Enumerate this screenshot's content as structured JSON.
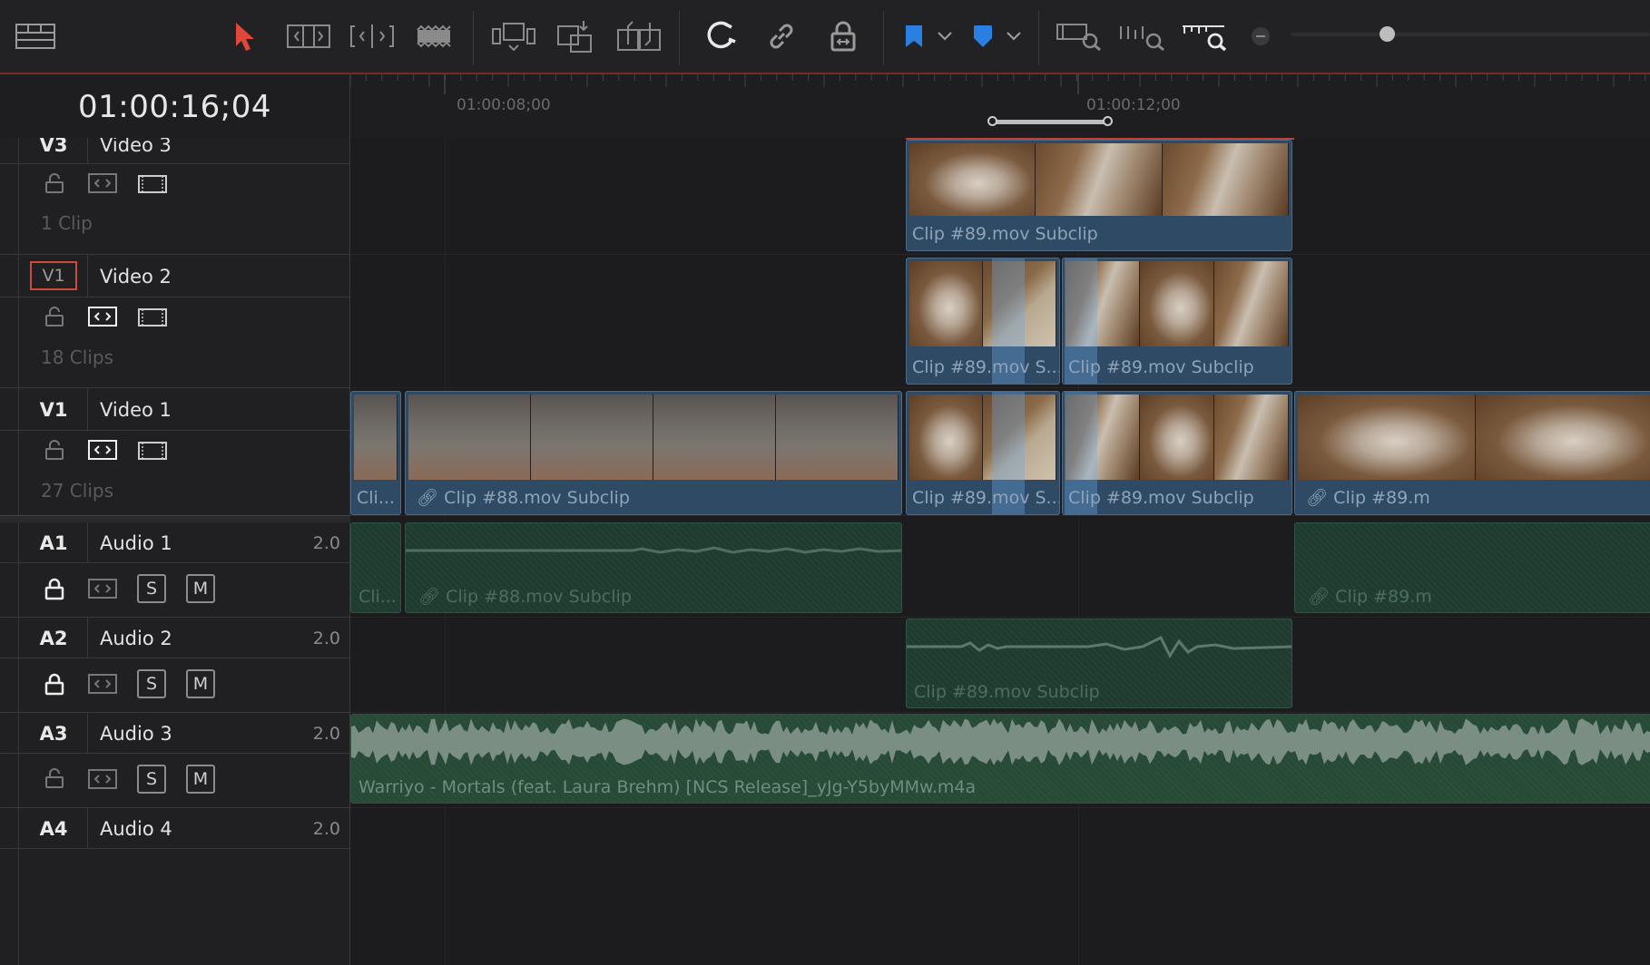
{
  "timecode": "01:00:16;04",
  "ruler": {
    "marks": [
      "01:00:08;00",
      "01:00:12;00"
    ]
  },
  "toolbar": {
    "icons": [
      "timeline-view-icon",
      "selection-arrow-icon",
      "trim-edit-icon",
      "dynamic-trim-icon",
      "blade-edit-icon",
      "insert-clip-icon",
      "overwrite-clip-icon",
      "replace-clip-icon",
      "snapping-icon",
      "linked-selection-icon",
      "position-lock-icon",
      "flag-icon",
      "marker-icon",
      "zoom-full-icon",
      "zoom-detail-icon",
      "zoom-custom-icon",
      "zoom-out-icon"
    ]
  },
  "tracks": {
    "v3": {
      "code": "V3",
      "name": "Video 3",
      "count": "1 Clip"
    },
    "v2": {
      "code": "V1",
      "name": "Video 2",
      "count": "18 Clips"
    },
    "v1": {
      "code": "V1",
      "name": "Video 1",
      "count": "27 Clips"
    },
    "a1": {
      "code": "A1",
      "name": "Audio 1",
      "channels": "2.0",
      "solo": "S",
      "mute": "M"
    },
    "a2": {
      "code": "A2",
      "name": "Audio 2",
      "channels": "2.0",
      "solo": "S",
      "mute": "M"
    },
    "a3": {
      "code": "A3",
      "name": "Audio 3",
      "channels": "2.0",
      "solo": "S",
      "mute": "M"
    },
    "a4": {
      "code": "A4",
      "name": "Audio 4",
      "channels": "2.0"
    }
  },
  "clips": {
    "v3_1": "Clip #89.mov Subclip",
    "v2_1": "Clip #89.mov S...",
    "v2_2": "Clip #89.mov Subclip",
    "v1_0": "Cli...",
    "v1_1": "Clip #88.mov Subclip",
    "v1_2": "Clip #89.mov S...",
    "v1_3": "Clip #89.mov Subclip",
    "v1_4": "Clip #89.m",
    "a1_0": "Cli...",
    "a1_1": "Clip #88.mov Subclip",
    "a1_2": "Clip #89.m",
    "a2_1": "Clip #89.mov Subclip",
    "a3_1": "Warriyo - Mortals (feat. Laura Brehm) [NCS Release]_yJg-Y5byMMw.m4a"
  },
  "colors": {
    "accent_red": "#e0463a",
    "flag_blue": "#2a7fe0",
    "video_clip": "#2e4a64",
    "audio_clip": "#1f3b2f"
  }
}
